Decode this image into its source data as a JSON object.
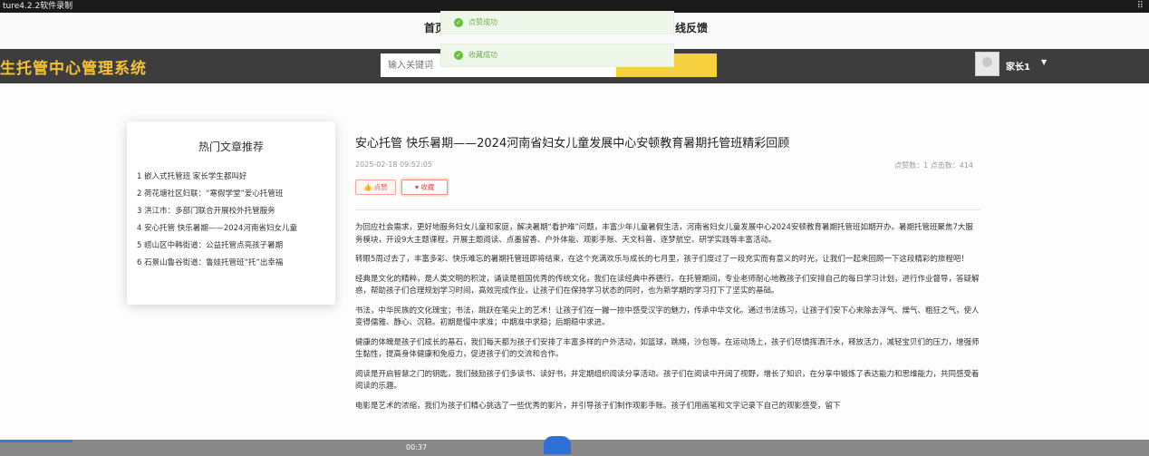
{
  "recorder": {
    "title": "ture4.2.2软件录制"
  },
  "topnav": {
    "home": "首页",
    "feedback": "线反馈"
  },
  "header": {
    "brand": "生托管中心管理系统",
    "search_placeholder": "输入关键词",
    "user": "家长1"
  },
  "toasts": {
    "like": "点赞成功",
    "favorite": "收藏成功"
  },
  "sidebar": {
    "title": "热门文章推荐",
    "items": [
      "1  嵌入式托管班 家长学生都叫好",
      "2  荷花塘社区妇联：“寒假学堂”爱心托管班",
      "3  洪江市：多部门联合开展校外托管服务",
      "4  安心托管 快乐暑期——2024河南省妇女儿童",
      "5  崂山区中韩街道：公益托管点亮孩子暑期",
      "6  石景山鲁谷街道：鲁娃托管班“托”出幸福"
    ]
  },
  "article": {
    "title": "安心托管 快乐暑期——2024河南省妇女儿童发展中心安顿教育暑期托管班精彩回顾",
    "date": "2025-02-18 09:52:05",
    "stats": "点赞数：1   点击数：414",
    "like_label": "点赞",
    "fav_label": "收藏",
    "paragraphs": [
      "为回应社会需求，更好地服务妇女儿童和家庭，解决暑期“看护难”问题，丰富少年儿童暑假生活，河南省妇女儿童发展中心2024安顿教育暑期托管班如期开办。暑期托管班聚焦7大服务模块，开设9大主题课程，开展主题阅读、点墨留香、户外体能、观影手账、天文科普、逐梦航空、研学实践等丰富活动。",
      "转眼5周过去了，丰富多彩、快乐难忘的暑期托管班即将结束，在这个充满欢乐与成长的七月里，孩子们度过了一段充实而有意义的时光，让我们一起来回顾一下这段精彩的旅程吧！",
      "经典是文化的精粹，是人类文明的积淀，诵读是祖国优秀的传统文化，我们在读经典中养德行。在托管期间，专业老师耐心地教孩子们安排自己的每日学习计划，进行作业督导，答疑解惑，帮助孩子们合理规划学习时间，高效完成作业，让孩子们在保持学习状态的同时，也为新学期的学习打下了坚实的基础。",
      "书法，中华民族的文化瑰宝；书法，跳跃在笔尖上的艺术！让孩子们在一撇一捺中感受汉字的魅力，传承中华文化。通过书法练习，让孩子们安下心来除去浮气、燥气、粗狂之气，使人变得儒雅、静心、沉稳。初期是慢中求准；中期准中求稳；后期稳中求进。",
      "健康的体魄是孩子们成长的基石，我们每天都为孩子们安排了丰富多样的户外活动，如篮球，跳绳，沙包等。在运动场上，孩子们尽情挥洒汗水，释放活力，减轻宝贝们的压力，增强师生黏性，提高身体健康和免疫力，促进孩子们的交流和合作。",
      "阅读是开启智慧之门的钥匙，我们鼓励孩子们多读书、读好书，并定期组织阅读分享活动。孩子们在阅读中开阔了视野，增长了知识，在分享中锻炼了表达能力和思维能力，共同感受着阅读的乐趣。",
      "电影是艺术的浓缩，我们为孩子们精心挑选了一些优秀的影片，并引导孩子们制作观影手账。孩子们用画笔和文字记录下自己的观影感受，留下"
    ]
  },
  "player": {
    "time": "00:37"
  }
}
